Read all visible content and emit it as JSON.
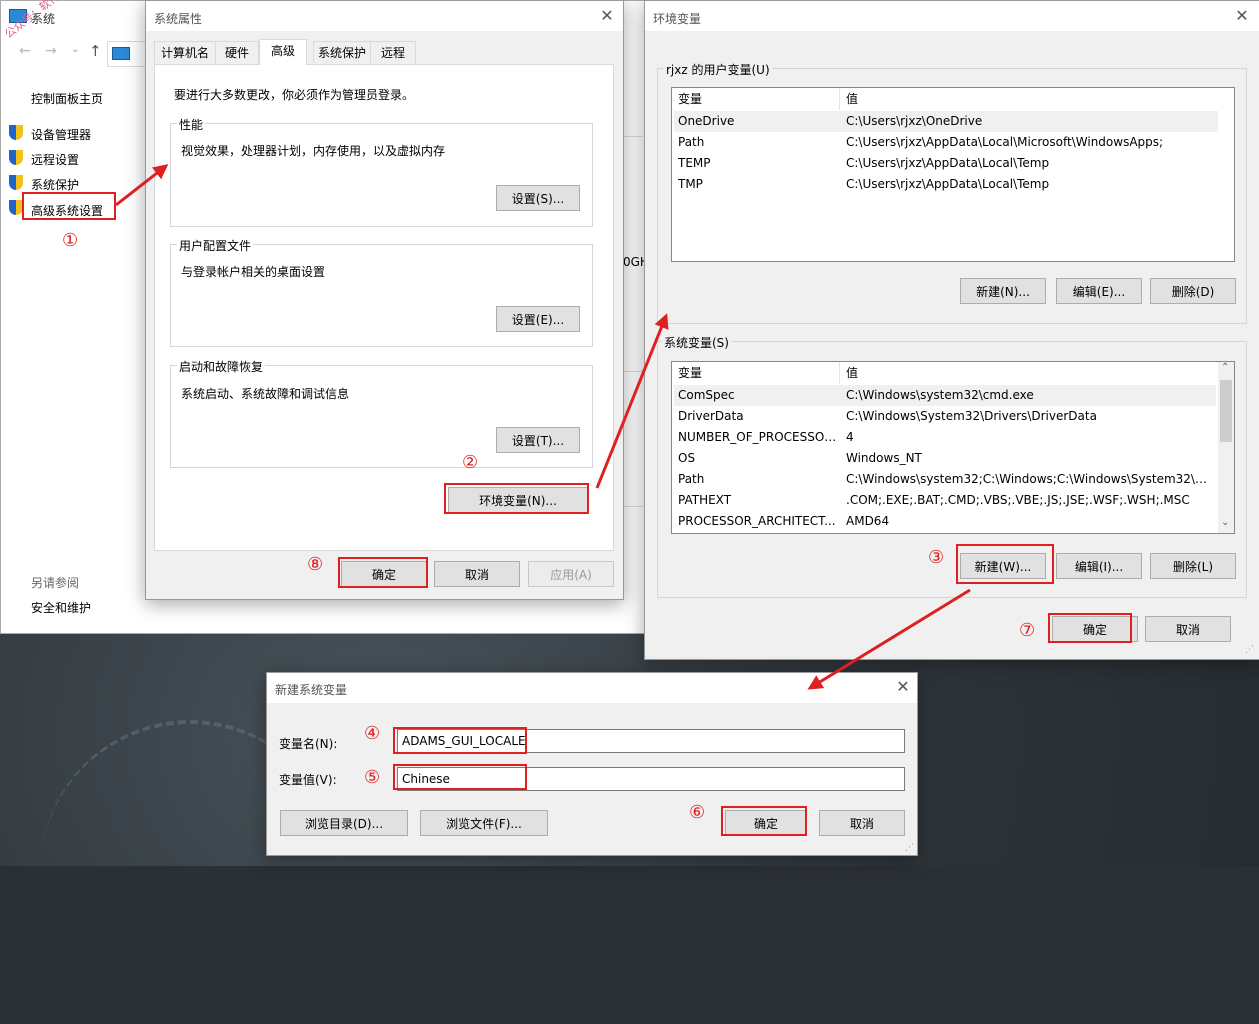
{
  "sys_window": {
    "title": "系统",
    "watermark": "公众号：软件智库",
    "sidebar": {
      "home": "控制面板主页",
      "items": [
        "设备管理器",
        "远程设置",
        "系统保护",
        "高级系统设置"
      ],
      "see_also": "另请参阅",
      "security": "安全和维护"
    },
    "partial_text": "0GH"
  },
  "sys_props": {
    "title": "系统属性",
    "tabs": [
      "计算机名",
      "硬件",
      "高级",
      "系统保护",
      "远程"
    ],
    "admin_note": "要进行大多数更改，你必须作为管理员登录。",
    "performance": {
      "label": "性能",
      "desc": "视觉效果，处理器计划，内存使用，以及虚拟内存",
      "button": "设置(S)..."
    },
    "profiles": {
      "label": "用户配置文件",
      "desc": "与登录帐户相关的桌面设置",
      "button": "设置(E)..."
    },
    "startup": {
      "label": "启动和故障恢复",
      "desc": "系统启动、系统故障和调试信息",
      "button": "设置(T)..."
    },
    "env_button": "环境变量(N)...",
    "ok": "确定",
    "cancel": "取消",
    "apply": "应用(A)"
  },
  "env_vars": {
    "title": "环境变量",
    "user_group": "rjxz 的用户变量(U)",
    "col_var": "变量",
    "col_val": "值",
    "user_rows": [
      {
        "name": "OneDrive",
        "value": "C:\\Users\\rjxz\\OneDrive"
      },
      {
        "name": "Path",
        "value": "C:\\Users\\rjxz\\AppData\\Local\\Microsoft\\WindowsApps;"
      },
      {
        "name": "TEMP",
        "value": "C:\\Users\\rjxz\\AppData\\Local\\Temp"
      },
      {
        "name": "TMP",
        "value": "C:\\Users\\rjxz\\AppData\\Local\\Temp"
      }
    ],
    "user_new": "新建(N)...",
    "user_edit": "编辑(E)...",
    "user_delete": "删除(D)",
    "sys_group": "系统变量(S)",
    "sys_rows": [
      {
        "name": "ComSpec",
        "value": "C:\\Windows\\system32\\cmd.exe"
      },
      {
        "name": "DriverData",
        "value": "C:\\Windows\\System32\\Drivers\\DriverData"
      },
      {
        "name": "NUMBER_OF_PROCESSORS",
        "value": "4"
      },
      {
        "name": "OS",
        "value": "Windows_NT"
      },
      {
        "name": "Path",
        "value": "C:\\Windows\\system32;C:\\Windows;C:\\Windows\\System32\\Wb..."
      },
      {
        "name": "PATHEXT",
        "value": ".COM;.EXE;.BAT;.CMD;.VBS;.VBE;.JS;.JSE;.WSF;.WSH;.MSC"
      },
      {
        "name": "PROCESSOR_ARCHITECT...",
        "value": "AMD64"
      }
    ],
    "sys_new": "新建(W)...",
    "sys_edit": "编辑(I)...",
    "sys_delete": "删除(L)",
    "ok": "确定",
    "cancel": "取消"
  },
  "new_var": {
    "title": "新建系统变量",
    "name_label": "变量名(N):",
    "name_value": "ADAMS_GUI_LOCALE",
    "value_label": "变量值(V):",
    "value_value": "Chinese",
    "browse_dir": "浏览目录(D)...",
    "browse_file": "浏览文件(F)...",
    "ok": "确定",
    "cancel": "取消"
  },
  "steps": [
    "①",
    "②",
    "③",
    "④",
    "⑤",
    "⑥",
    "⑦",
    "⑧"
  ],
  "colors": {
    "annotation_red": "#e02020",
    "shield_blue": "#1f64c8",
    "shield_yellow": "#f3c11b"
  }
}
